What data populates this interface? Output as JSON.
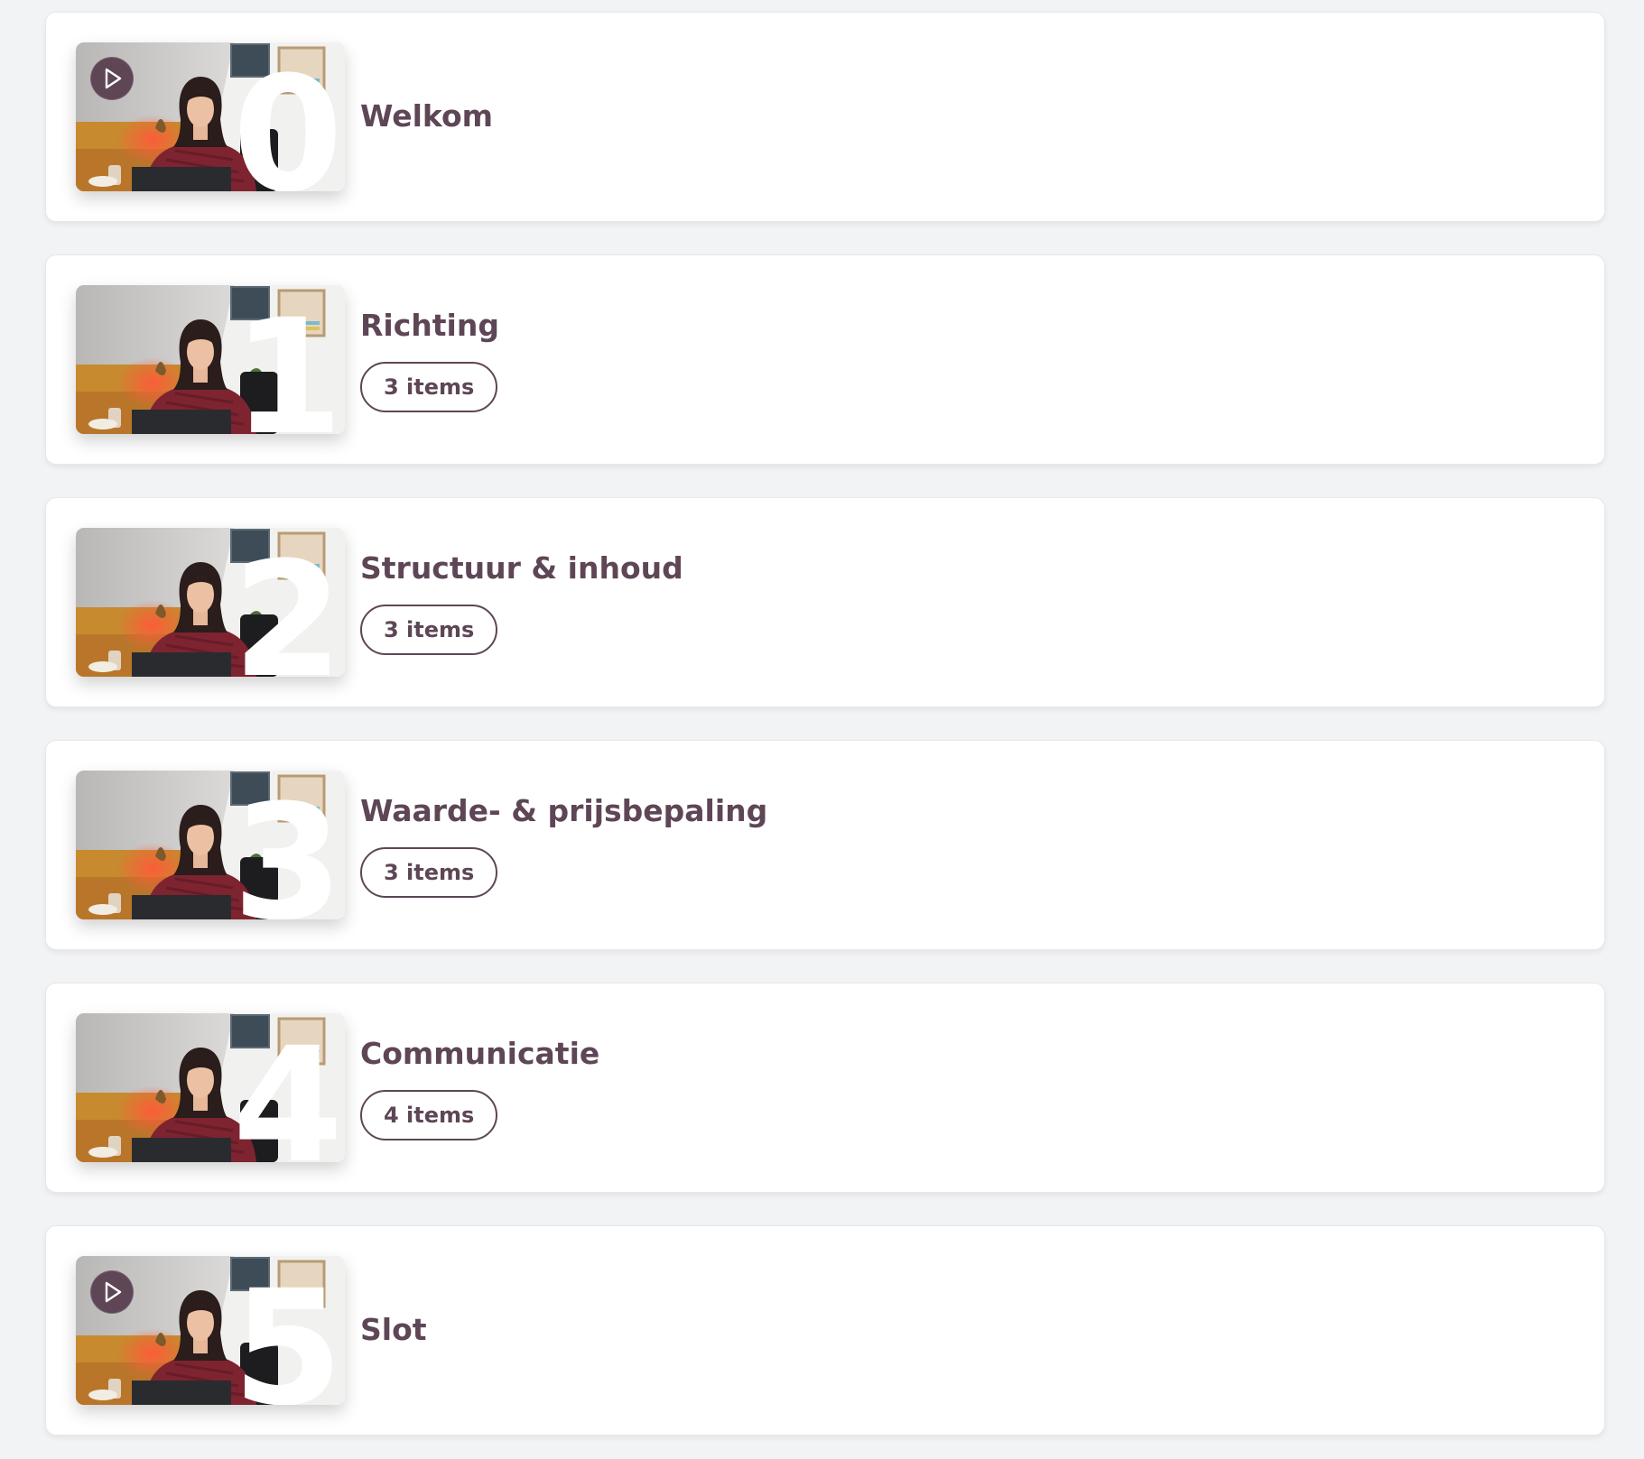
{
  "modules": [
    {
      "number": "0",
      "title": "Welkom",
      "items_label": "",
      "play_icon": "play-icon"
    },
    {
      "number": "1",
      "title": "Richting",
      "items_label": "3 items",
      "play_icon": ""
    },
    {
      "number": "2",
      "title": "Structuur & inhoud",
      "items_label": "3 items",
      "play_icon": ""
    },
    {
      "number": "3",
      "title": "Waarde- & prijsbepaling",
      "items_label": "3 items",
      "play_icon": ""
    },
    {
      "number": "4",
      "title": "Communicatie",
      "items_label": "4 items",
      "play_icon": ""
    },
    {
      "number": "5",
      "title": "Slot",
      "items_label": "",
      "play_icon": "play-icon"
    }
  ],
  "colors": {
    "accent": "#5e4656",
    "card": "#ffffff",
    "page_background": "#f2f3f5"
  }
}
